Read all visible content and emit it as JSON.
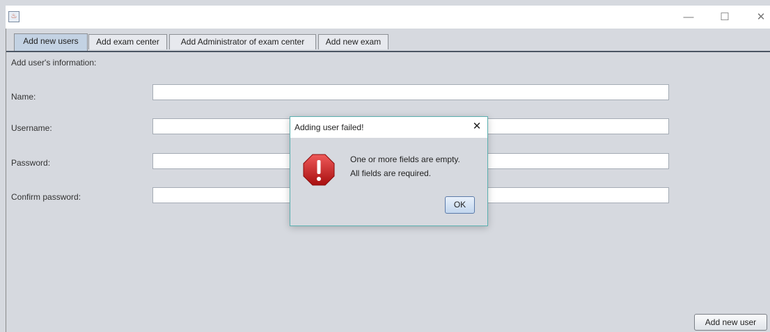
{
  "window": {
    "controls": {
      "minimize": "—",
      "maximize": "☐",
      "close": "✕"
    }
  },
  "tabs": [
    {
      "label": "Add new users",
      "active": true
    },
    {
      "label": "Add exam center",
      "active": false
    },
    {
      "label": "Add Administrator of exam center",
      "active": false
    },
    {
      "label": "Add new exam",
      "active": false
    }
  ],
  "form": {
    "heading": "Add user's information:",
    "fields": [
      {
        "label": "Name:",
        "value": ""
      },
      {
        "label": "Username:",
        "value": ""
      },
      {
        "label": "Password:",
        "value": ""
      },
      {
        "label": "Confirm password:",
        "value": ""
      }
    ],
    "submit_label": "Add new user"
  },
  "dialog": {
    "title": "Adding user failed!",
    "close_glyph": "✕",
    "icon": "error-icon",
    "message_line1": "One or more fields are empty.",
    "message_line2": "All fields are required.",
    "ok_label": "OK"
  },
  "colors": {
    "background": "#d6d9df",
    "active_tab": "#c3d2e3",
    "dialog_border": "#5bb0b0",
    "error_red": "#c81d1d"
  }
}
